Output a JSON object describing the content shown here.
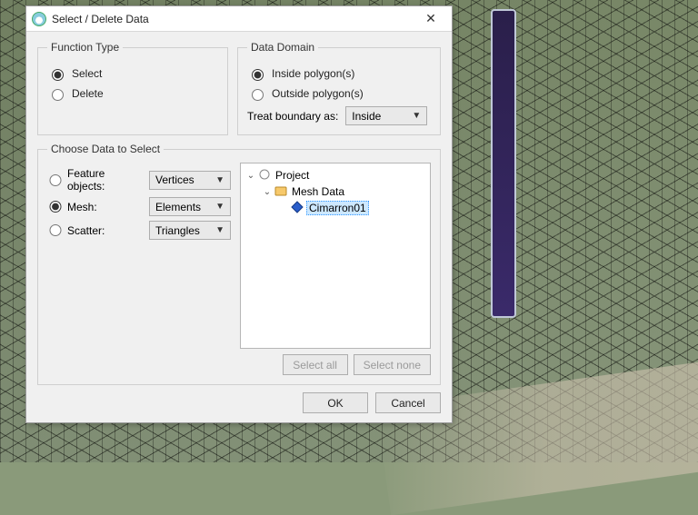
{
  "dialog": {
    "title": "Select / Delete Data",
    "functionType": {
      "legend": "Function Type",
      "options": {
        "select": "Select",
        "delete": "Delete"
      },
      "selected": "select"
    },
    "dataDomain": {
      "legend": "Data Domain",
      "options": {
        "inside": "Inside polygon(s)",
        "outside": "Outside polygon(s)"
      },
      "selected": "inside",
      "treatLabel": "Treat boundary as:",
      "treatValue": "Inside"
    },
    "choose": {
      "legend": "Choose Data to Select",
      "feature": {
        "label": "Feature objects:",
        "combo": "Vertices"
      },
      "mesh": {
        "label": "Mesh:",
        "combo": "Elements"
      },
      "scatter": {
        "label": "Scatter:",
        "combo": "Triangles"
      },
      "selected": "mesh"
    },
    "tree": {
      "root": "Project",
      "child": "Mesh Data",
      "leaf": "Cimarron01"
    },
    "buttons": {
      "selectAll": "Select all",
      "selectNone": "Select none",
      "ok": "OK",
      "cancel": "Cancel"
    }
  }
}
